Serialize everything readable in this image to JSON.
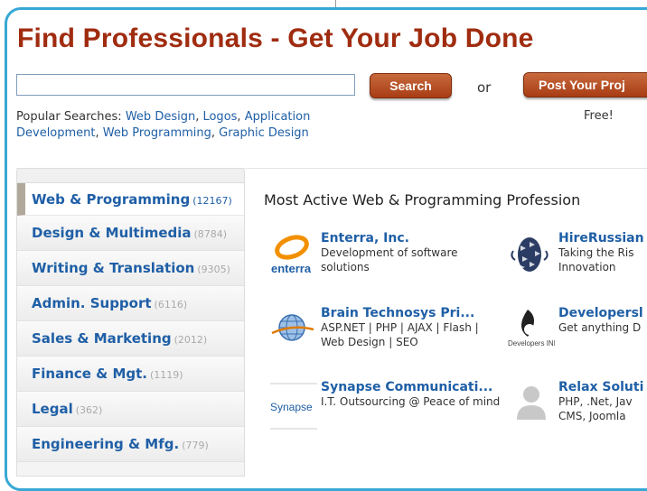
{
  "headline": "Find Professionals - Get Your Job Done",
  "search": {
    "value": "",
    "placeholder": "",
    "button": "Search"
  },
  "or_label": "or",
  "post": {
    "button": "Post Your Proj",
    "sub": "Free!"
  },
  "popular": {
    "label": "Popular Searches:",
    "links": [
      "Web Design",
      "Logos",
      "Application Development",
      "Web Programming",
      "Graphic Design"
    ]
  },
  "sidebar": {
    "items": [
      {
        "name": "Web & Programming",
        "count": "(12167)"
      },
      {
        "name": "Design & Multimedia",
        "count": "(8784)"
      },
      {
        "name": "Writing & Translation",
        "count": "(9305)"
      },
      {
        "name": "Admin. Support",
        "count": "(6116)"
      },
      {
        "name": "Sales & Marketing",
        "count": "(2012)"
      },
      {
        "name": "Finance & Mgt.",
        "count": "(1119)"
      },
      {
        "name": "Legal",
        "count": "(362)"
      },
      {
        "name": "Engineering & Mfg.",
        "count": "(779)"
      }
    ]
  },
  "section_title": "Most Active Web & Programming Profession",
  "professionals": [
    {
      "name": "Enterra, Inc.",
      "desc": "Development of software solutions",
      "logo_text": "enterra",
      "icon": "enterra-logo"
    },
    {
      "name": "HireRussian",
      "desc": "Taking the Ris Innovation",
      "icon": "pinecone-logo"
    },
    {
      "name": "Brain Technosys Pri...",
      "desc": "ASP.NET | PHP | AJAX | Flash | Web Design | SEO",
      "icon": "globe-logo"
    },
    {
      "name": "Developersl",
      "desc": "Get anything D",
      "logo_text": "Developers INN",
      "icon": "developers-inn-logo"
    },
    {
      "name": "Synapse Communicati...",
      "desc": "I.T. Outsourcing @ Peace of mind",
      "logo_text": "Synapse",
      "icon": "synapse-logo"
    },
    {
      "name": "Relax Soluti",
      "desc": "PHP, .Net, Jav CMS, Joomla",
      "icon": "avatar-placeholder"
    }
  ],
  "colors": {
    "brand": "#a02c10",
    "link": "#1f5fa6",
    "frame": "#38a8d4",
    "button": "#b04a1e"
  }
}
